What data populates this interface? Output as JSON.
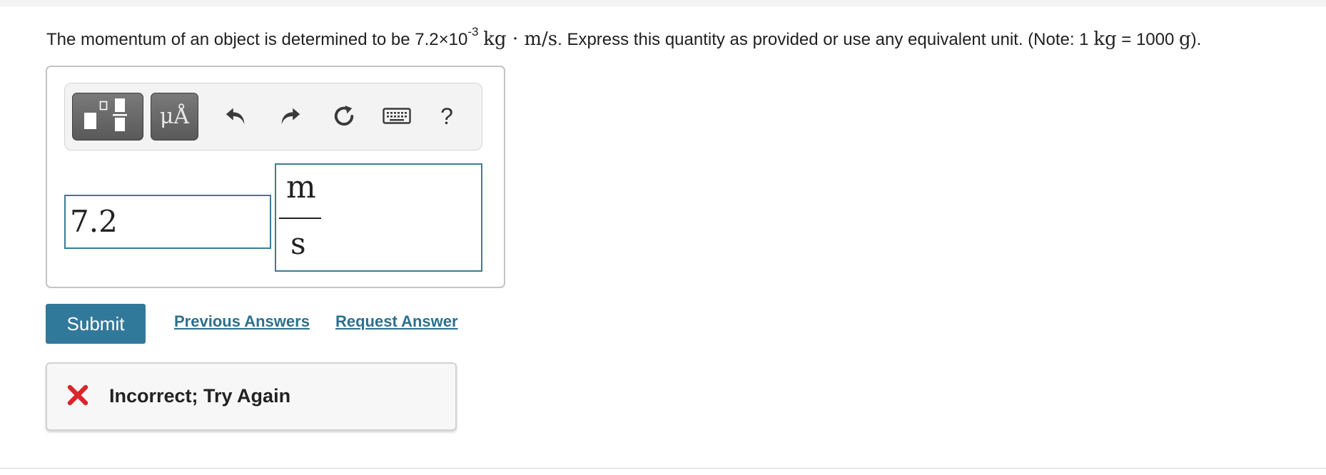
{
  "question": {
    "prefix": "The momentum of an object is determined to be 7.2",
    "times": "×",
    "base": "10",
    "exponent": "-3",
    "unit": "kg · m/s",
    "mid": ". Express this quantity as provided or use any equivalent unit. (Note: 1 ",
    "kg": "kg",
    "equals": " = 1000 ",
    "g": "g",
    "suffix": ")."
  },
  "toolbar": {
    "units_label": "μÅ",
    "help_label": "?",
    "icons": [
      "templates-icon",
      "units-icon",
      "undo-icon",
      "redo-icon",
      "reset-icon",
      "keyboard-icon",
      "help-icon"
    ]
  },
  "answer": {
    "value": "7.2",
    "unit_numerator": "m",
    "unit_denominator": "s"
  },
  "actions": {
    "submit_label": "Submit",
    "previous_answers_label": "Previous Answers",
    "request_answer_label": "Request Answer"
  },
  "feedback": {
    "text": "Incorrect; Try Again",
    "status": "incorrect"
  },
  "colors": {
    "accent": "#31799b",
    "link": "#2d6f8e",
    "input_border": "#3b7c96",
    "error": "#d9262b"
  }
}
